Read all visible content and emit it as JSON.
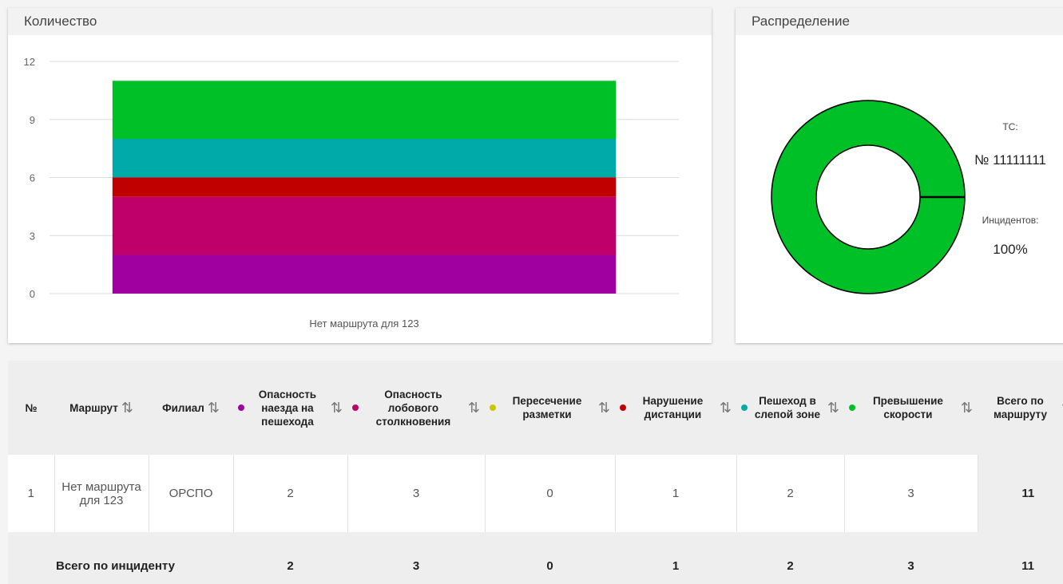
{
  "count_panel": {
    "title": "Количество"
  },
  "dist_panel": {
    "title": "Распределение",
    "vehicle_label": "ТС:",
    "vehicle_number": "№ 11111111",
    "incidents_label": "Инцидентов:",
    "incidents_value": "100%"
  },
  "chart_data": [
    {
      "type": "bar",
      "stacked": true,
      "categories": [
        "Нет маршрута для 123"
      ],
      "ylim": [
        0,
        12
      ],
      "yticks": [
        0,
        3,
        6,
        9,
        12
      ],
      "grid": true,
      "series": [
        {
          "values": [
            2
          ],
          "color": "#a000a0"
        },
        {
          "values": [
            3
          ],
          "color": "#c0006a"
        },
        {
          "values": [
            0
          ],
          "color": "#c8c800"
        },
        {
          "values": [
            1
          ],
          "color": "#c00000"
        },
        {
          "values": [
            2
          ],
          "color": "#00aaa8"
        },
        {
          "values": [
            3
          ],
          "color": "#00c028"
        }
      ]
    },
    {
      "type": "pie",
      "donut": true,
      "slices": [
        {
          "value": 100,
          "color": "#00c028"
        }
      ]
    }
  ],
  "table": {
    "headers": {
      "num": "№",
      "route": "Маршрут",
      "branch": "Филиал",
      "c1": "Опасность наезда на пешехода",
      "c2": "Опасность лобового столкновения",
      "c3": "Пересечение разметки",
      "c4": "Нарушение дистанции",
      "c5": "Пешеход в слепой зоне",
      "c6": "Превышение скорости",
      "total": "Всего по маршруту"
    },
    "dot_colors": [
      "#a000a0",
      "#c0006a",
      "#c8c800",
      "#c00000",
      "#00aaa8",
      "#00c028"
    ],
    "row": {
      "num": "1",
      "route": "Нет маршрута для 123",
      "branch": "ОРСПО",
      "c1": "2",
      "c2": "3",
      "c3": "0",
      "c4": "1",
      "c5": "2",
      "c6": "3",
      "total": "11"
    },
    "totals": {
      "label": "Всего по инциденту",
      "c1": "2",
      "c2": "3",
      "c3": "0",
      "c4": "1",
      "c5": "2",
      "c6": "3",
      "total": "11"
    }
  }
}
